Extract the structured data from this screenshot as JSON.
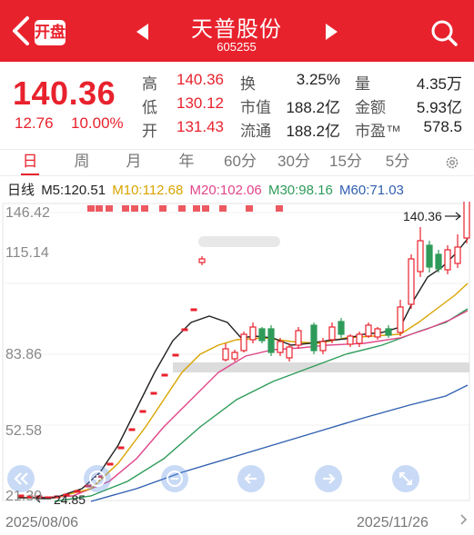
{
  "header": {
    "back_icon": "chevron-left-icon",
    "badge": "开盘",
    "title": "天普股份",
    "code": "605255",
    "prev_icon": "triangle-left-icon",
    "next_icon": "triangle-right-icon",
    "search_icon": "search-icon",
    "bg_color": "#e8222d"
  },
  "quote": {
    "price": "140.36",
    "change": "12.76",
    "change_pct": "10.00%",
    "high_label": "高",
    "high": "140.36",
    "low_label": "低",
    "low": "130.12",
    "open_label": "开",
    "open": "131.43",
    "turnover_label": "换",
    "turnover": "3.25%",
    "mktcap_label": "市值",
    "mktcap": "188.2亿",
    "float_label": "流通",
    "float": "188.2亿",
    "vol_label": "量",
    "vol": "4.35万",
    "amount_label": "金额",
    "amount": "5.93亿",
    "pe_label": "市盈™",
    "pe": "578.5"
  },
  "tabs": [
    "日",
    "周",
    "月",
    "年",
    "60分",
    "30分",
    "15分",
    "5分"
  ],
  "active_tab": "日",
  "ma": {
    "label": "日线",
    "m5": "M5:120.51",
    "m10": "M10:112.68",
    "m20": "M20:102.06",
    "m30": "M30:98.16",
    "m60": "M60:71.03",
    "colors": {
      "m5": "#222222",
      "m10": "#d9a400",
      "m20": "#e0468a",
      "m30": "#2e9b5a",
      "m60": "#2f5fb0"
    }
  },
  "axis": {
    "y_labels": [
      "146.42",
      "115.14",
      "83.86",
      "52.58",
      "21.30"
    ],
    "high_marker": "140.36",
    "low_marker": "24.85",
    "start_date": "2025/08/06",
    "end_date": "2025/11/26"
  },
  "controls": [
    "double-left-icon",
    "zoom-in-icon",
    "zoom-out-icon",
    "arrow-left-icon",
    "arrow-right-icon",
    "expand-icon"
  ]
}
